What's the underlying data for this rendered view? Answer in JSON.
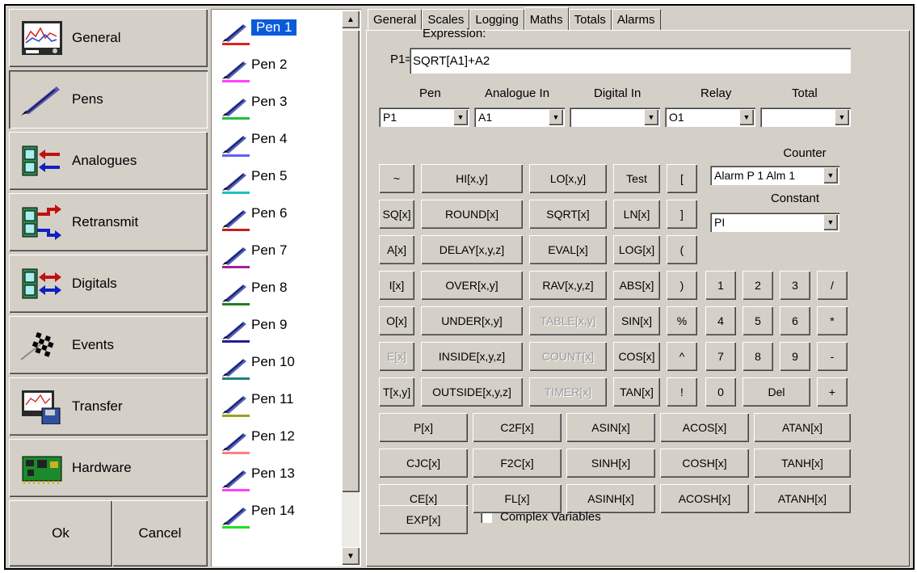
{
  "nav": {
    "items": [
      {
        "label": "General",
        "icon": "recorder-screen-icon"
      },
      {
        "label": "Pens",
        "icon": "quill-pen-icon"
      },
      {
        "label": "Analogues",
        "icon": "analogue-io-icon"
      },
      {
        "label": "Retransmit",
        "icon": "retransmit-io-icon"
      },
      {
        "label": "Digitals",
        "icon": "digital-io-icon"
      },
      {
        "label": "Events",
        "icon": "checkered-flag-icon"
      },
      {
        "label": "Transfer",
        "icon": "transfer-disk-icon"
      },
      {
        "label": "Hardware",
        "icon": "circuit-board-icon"
      }
    ],
    "ok": "Ok",
    "cancel": "Cancel"
  },
  "pens": [
    {
      "label": "Pen 1",
      "color": "#e02020"
    },
    {
      "label": "Pen 2",
      "color": "#ff40ff"
    },
    {
      "label": "Pen 3",
      "color": "#20c040"
    },
    {
      "label": "Pen 4",
      "color": "#6060ff"
    },
    {
      "label": "Pen 5",
      "color": "#20c0c0"
    },
    {
      "label": "Pen 6",
      "color": "#c02020"
    },
    {
      "label": "Pen 7",
      "color": "#a020a0"
    },
    {
      "label": "Pen 8",
      "color": "#208020"
    },
    {
      "label": "Pen 9",
      "color": "#202090"
    },
    {
      "label": "Pen 10",
      "color": "#208080"
    },
    {
      "label": "Pen 11",
      "color": "#a0a020"
    },
    {
      "label": "Pen 12",
      "color": "#ff8080"
    },
    {
      "label": "Pen 13",
      "color": "#ff40ff"
    },
    {
      "label": "Pen 14",
      "color": "#20e020"
    }
  ],
  "selected_pen_index": 0,
  "tabs": [
    "General",
    "Scales",
    "Logging",
    "Maths",
    "Totals",
    "Alarms"
  ],
  "active_tab": "Maths",
  "expression": {
    "label": "Expression:",
    "prefix": "P1=",
    "value": "SQRT[A1]+A2"
  },
  "selectors": {
    "pen": {
      "header": "Pen",
      "value": "P1"
    },
    "analogue": {
      "header": "Analogue In",
      "value": "A1"
    },
    "digital": {
      "header": "Digital In",
      "value": ""
    },
    "relay": {
      "header": "Relay",
      "value": "O1"
    },
    "total": {
      "header": "Total",
      "value": ""
    },
    "counter": {
      "header": "Counter",
      "value": "Alarm P 1 Alm 1"
    },
    "constant": {
      "header": "Constant",
      "value": "PI"
    }
  },
  "buttons": {
    "tilde": "~",
    "hi": "HI[x,y]",
    "lo": "LO[x,y]",
    "test": "Test",
    "lbracket": "[",
    "sq": "SQ[x]",
    "round": "ROUND[x]",
    "sqrt": "SQRT[x]",
    "ln": "LN[x]",
    "rbracket": "]",
    "a": "A[x]",
    "delay": "DELAY[x,y,z]",
    "eval": "EVAL[x]",
    "log": "LOG[x]",
    "lparen": "(",
    "i": "I[x]",
    "over": "OVER[x,y]",
    "rav": "RAV[x,y,z]",
    "abs": "ABS[x]",
    "rparen": ")",
    "o": "O[x]",
    "under": "UNDER[x,y]",
    "table": "TABLE[x,y]",
    "sin": "SIN[x]",
    "percent": "%",
    "e": "E[x]",
    "inside": "INSIDE[x,y,z]",
    "count": "COUNT[x]",
    "cos": "COS[x]",
    "caret": "^",
    "t": "T[x,y]",
    "outside": "OUTSIDE[x,y,z]",
    "timer": "TIMER[x]",
    "tan": "TAN[x]",
    "bang": "!",
    "k1": "1",
    "k2": "2",
    "k3": "3",
    "div": "/",
    "k4": "4",
    "k5": "5",
    "k6": "6",
    "mul": "*",
    "k7": "7",
    "k8": "8",
    "k9": "9",
    "minus": "-",
    "k0": "0",
    "del": "Del",
    "plus": "+",
    "p": "P[x]",
    "c2f": "C2F[x]",
    "asin": "ASIN[x]",
    "acos": "ACOS[x]",
    "atan": "ATAN[x]",
    "cjc": "CJC[x]",
    "f2c": "F2C[x]",
    "sinh": "SINH[x]",
    "cosh": "COSH[x]",
    "tanh": "TANH[x]",
    "ce": "CE[x]",
    "fl": "FL[x]",
    "asinh": "ASINH[x]",
    "acosh": "ACOSH[x]",
    "atanh": "ATANH[x]",
    "exp": "EXP[x]"
  },
  "complex_variables": {
    "label": "Complex Variables",
    "checked": false
  }
}
